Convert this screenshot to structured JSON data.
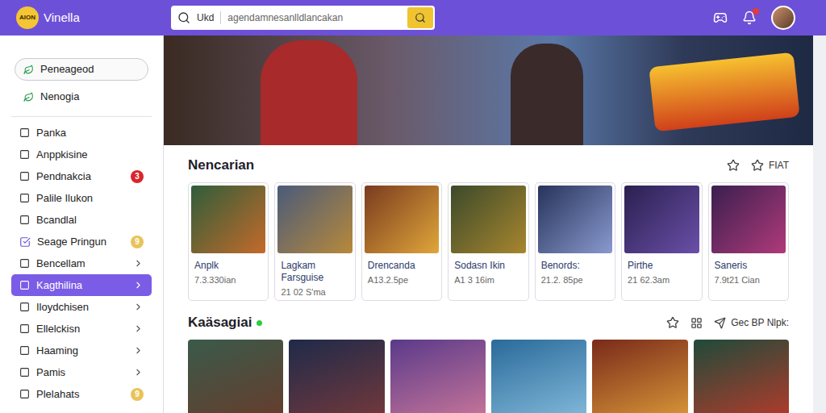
{
  "header": {
    "logo": "AION",
    "app_name": "Vinella",
    "search": {
      "scope": "Ukd",
      "placeholder": "agendamnesanlldlancakan"
    },
    "notification_badge": true
  },
  "sidebar": {
    "top_items": [
      {
        "label": "Peneageod",
        "selected": true
      },
      {
        "label": "Nenogia",
        "selected": false
      }
    ],
    "items": [
      {
        "label": "Panka",
        "checked": false,
        "chevron": false,
        "selected": false,
        "badge": null
      },
      {
        "label": "Anppkisine",
        "checked": false,
        "chevron": false,
        "selected": false,
        "badge": null
      },
      {
        "label": "Pendnakcia",
        "checked": false,
        "chevron": false,
        "selected": false,
        "badge": {
          "text": "3",
          "color": "#d9262c"
        }
      },
      {
        "label": "Palile Ilukon",
        "checked": false,
        "chevron": false,
        "selected": false,
        "badge": null
      },
      {
        "label": "Bcandlal",
        "checked": false,
        "chevron": false,
        "selected": false,
        "badge": null
      },
      {
        "label": "Seage Pringun",
        "checked": true,
        "chevron": false,
        "selected": false,
        "badge": {
          "text": "9",
          "color": "#e9c35a"
        }
      },
      {
        "label": "Bencellam",
        "checked": false,
        "chevron": true,
        "selected": false,
        "badge": null
      },
      {
        "label": "Kagthilina",
        "checked": false,
        "chevron": true,
        "selected": true,
        "badge": null
      },
      {
        "label": "Iloydchisen",
        "checked": false,
        "chevron": true,
        "selected": false,
        "badge": null
      },
      {
        "label": "Ellelckisn",
        "checked": false,
        "chevron": true,
        "selected": false,
        "badge": null
      },
      {
        "label": "Haaming",
        "checked": false,
        "chevron": true,
        "selected": false,
        "badge": null
      },
      {
        "label": "Pamis",
        "checked": false,
        "chevron": true,
        "selected": false,
        "badge": null
      },
      {
        "label": "Plelahats",
        "checked": false,
        "chevron": false,
        "selected": false,
        "badge": {
          "text": "9",
          "color": "#e9c35a"
        }
      }
    ]
  },
  "sections": [
    {
      "title": "Nencarian",
      "live": false,
      "action_label": "FIAT",
      "cards": [
        {
          "title": "Anplk",
          "subtitle": "7.3.330ian"
        },
        {
          "title": "Lagkam Farsguise",
          "subtitle": "21 02 S'ma"
        },
        {
          "title": "Drencanda",
          "subtitle": "A13.2.5pe"
        },
        {
          "title": "Sodasn Ikin",
          "subtitle": "A1 3 16im"
        },
        {
          "title": "Benords:",
          "subtitle": "21.2. 85pe"
        },
        {
          "title": "Pirthe",
          "subtitle": "21 62.3am"
        },
        {
          "title": "Saneris",
          "subtitle": "7.9t21 Cian"
        }
      ]
    },
    {
      "title": "Kaäsagiai",
      "live": true,
      "action_label": "Gec BP Nlpk:",
      "cards": [
        {},
        {},
        {},
        {},
        {},
        {}
      ]
    }
  ]
}
